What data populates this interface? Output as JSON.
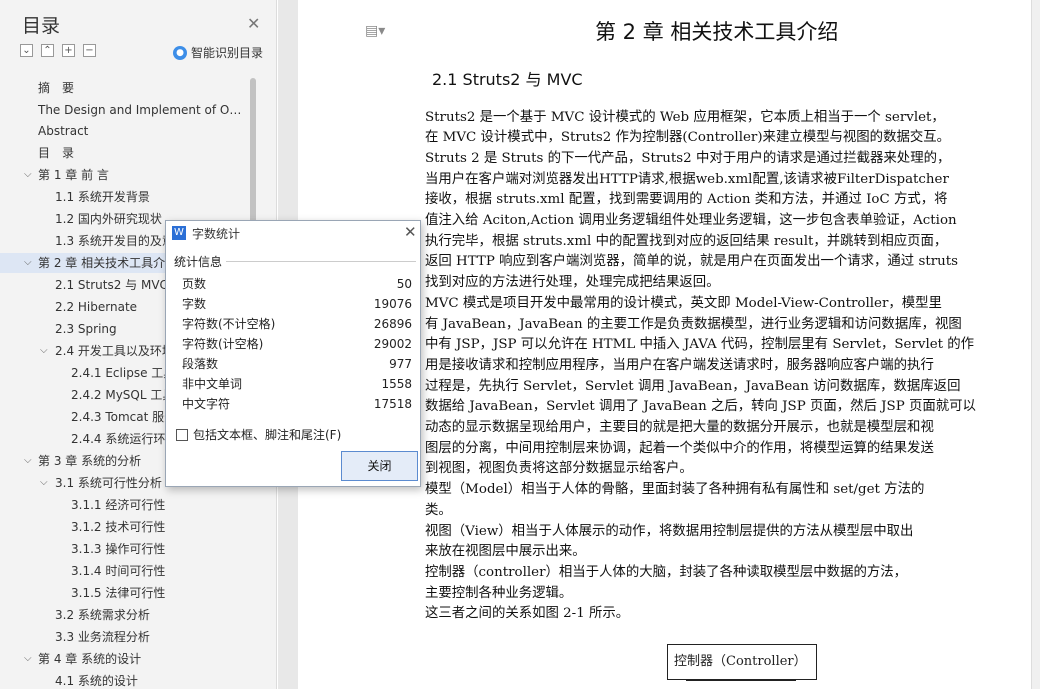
{
  "nav": {
    "title": "目录",
    "smart_label": "智能识别目录",
    "items": [
      "摘　要",
      "The Design and Implement of O…",
      "Abstract",
      "目　录",
      "第 1 章 前 言",
      "1.1 系统开发背景",
      "1.2 国内外研究现状",
      "1.3 系统开发目的及意",
      "第 2 章  相关技术工具介",
      "2.1 Struts2 与 MVC",
      "2.2 Hibernate",
      "2.3 Spring",
      "2.4 开发工具以及环境",
      "2.4.1 Eclipse 工具",
      "2.4.2 MySQL 工具",
      "2.4.3 Tomcat 服务",
      "2.4.4  系统运行环",
      "第 3 章     系统的分析",
      "3.1  系统可行性分析",
      "3.1.1  经济可行性",
      "3.1.2  技术可行性",
      "3.1.3  操作可行性",
      "3.1.4  时间可行性",
      "3.1.5  法律可行性",
      "3.2  系统需求分析",
      "3.3  业务流程分析",
      "第 4 章     系统的设计",
      "4.1  系统的设计"
    ]
  },
  "doc": {
    "chapter_title": "第 2 章  相关技术工具介绍",
    "section_title": "2.1 Struts2 与 MVC",
    "lines": [
      "    Struts2 是一个基于 MVC 设计模式的 Web 应用框架，它本质上相当于一个 servlet，",
      "在 MVC 设计模式中，Struts2 作为控制器(Controller)来建立模型与视图的数据交互。",
      "Struts 2 是 Struts 的下一代产品，Struts2 中对于用户的请求是通过拦截器来处理的，",
      "当用户在客户端对浏览器发出HTTP请求,根据web.xml配置,该请求被FilterDispatcher",
      "接收，根据 struts.xml 配置，找到需要调用的 Action 类和方法，并通过 IoC 方式，将",
      "值注入给 Aciton,Action 调用业务逻辑组件处理业务逻辑，这一步包含表单验证，Action",
      "执行完毕，根据 struts.xml 中的配置找到对应的返回结果 result，并跳转到相应页面，",
      "返回 HTTP 响应到客户端浏览器，简单的说，就是用户在页面发出一个请求，通过 struts",
      "找到对应的方法进行处理，处理完成把结果返回。",
      "    MVC 模式是项目开发中最常用的设计模式，英文即 Model-View-Controller，模型里",
      "有 JavaBean，JavaBean 的主要工作是负责数据模型，进行业务逻辑和访问数据库，视图",
      "中有 JSP，JSP 可以允许在 HTML 中插入 JAVA 代码，控制层里有 Servlet，Servlet 的作",
      "用是接收请求和控制应用程序，当用户在客户端发送请求时，服务器响应客户端的执行",
      "过程是，先执行 Servlet，Servlet 调用 JavaBean，JavaBean 访问数据库，数据库返回",
      "数据给 JavaBean，Servlet 调用了 JavaBean 之后，转向 JSP 页面，然后 JSP 页面就可以",
      "动态的显示数据呈现给用户，主要目的就是把大量的数据分开展示，也就是模型层和视",
      "图层的分离，中间用控制层来协调，起着一个类似中介的作用，将模型运算的结果发送",
      "到视图，视图负责将这部分数据显示给客户。",
      "    模型（Model）相当于人体的骨骼，里面封装了各种拥有私有属性和 set/get 方法的",
      "类。",
      "    视图（View）相当于人体展示的动作，将数据用控制层提供的方法从模型层中取出",
      "来放在视图层中展示出来。",
      "    控制器（controller）相当于人体的大脑，封装了各种读取模型层中数据的方法，",
      "主要控制各种业务逻辑。",
      "    这三者之间的关系如图 2-1 所示。"
    ],
    "diagram_box_label": "控制器（Controller）"
  },
  "dialog": {
    "title": "字数统计",
    "stats_heading": "统计信息",
    "stats": [
      {
        "label": "页数",
        "value": "50"
      },
      {
        "label": "字数",
        "value": "19076"
      },
      {
        "label": "字符数(不计空格)",
        "value": "26896"
      },
      {
        "label": "字符数(计空格)",
        "value": "29002"
      },
      {
        "label": "段落数",
        "value": "977"
      },
      {
        "label": "非中文单词",
        "value": "1558"
      },
      {
        "label": "中文字符",
        "value": "17518"
      }
    ],
    "checkbox_label": "包括文本框、脚注和尾注(F)",
    "close_label": "关闭"
  }
}
